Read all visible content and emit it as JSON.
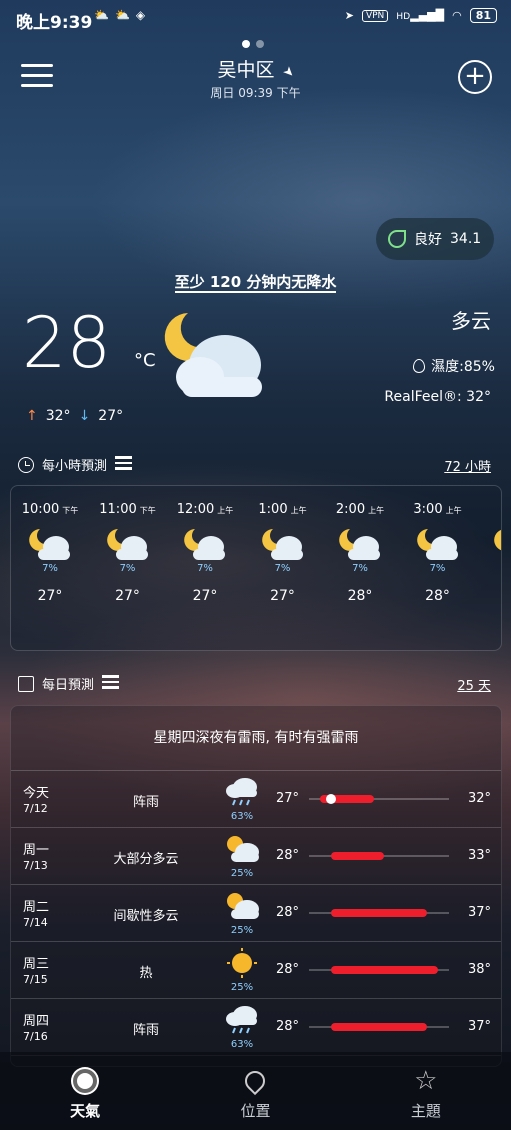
{
  "status_bar": {
    "time": "晚上9:39",
    "vpn": "VPN",
    "signal": "HD",
    "battery": "81"
  },
  "header": {
    "city": "吴中区",
    "datetime": "周日 09:39 下午",
    "page_count": 2,
    "active_page": 1
  },
  "air_quality": {
    "label": "良好",
    "value": "34.1",
    "color": "#7fe08a"
  },
  "nowcast": "至少 120 分钟内无降水",
  "current": {
    "temperature": "28",
    "unit": "°C",
    "condition": "多云",
    "humidity": "濕度:85%",
    "realfeel": "RealFeel®: 32°",
    "high": "32°",
    "low": "27°",
    "icon": "partly-cloudy-night-icon"
  },
  "hourly": {
    "title": "每小時預測",
    "link": "72 小時",
    "items": [
      {
        "time": "10:00",
        "period": "下午",
        "precip": "7%",
        "temp": "27°",
        "icon": "partly-cloudy-night-icon"
      },
      {
        "time": "11:00",
        "period": "下午",
        "precip": "7%",
        "temp": "27°",
        "icon": "partly-cloudy-night-icon"
      },
      {
        "time": "12:00",
        "period": "上午",
        "precip": "7%",
        "temp": "27°",
        "icon": "partly-cloudy-night-icon"
      },
      {
        "time": "1:00",
        "period": "上午",
        "precip": "7%",
        "temp": "27°",
        "icon": "partly-cloudy-night-icon"
      },
      {
        "time": "2:00",
        "period": "上午",
        "precip": "7%",
        "temp": "28°",
        "icon": "partly-cloudy-night-icon"
      },
      {
        "time": "3:00",
        "period": "上午",
        "precip": "7%",
        "temp": "28°",
        "icon": "partly-cloudy-night-icon"
      },
      {
        "time": "4:",
        "period": "",
        "precip": "",
        "temp": "",
        "icon": "partly-cloudy-night-icon"
      }
    ]
  },
  "daily": {
    "title": "每日預測",
    "link": "25 天",
    "summary": "星期四深夜有雷雨, 有时有强雷雨",
    "range_min": 26,
    "range_max": 39,
    "rows": [
      {
        "day": "今天",
        "date": "7/12",
        "cond": "阵雨",
        "precip": "63%",
        "lo": "27°",
        "hi": "32°",
        "lo_val": 27,
        "hi_val": 32,
        "current_val": 28,
        "icon": "rain-icon"
      },
      {
        "day": "周一",
        "date": "7/13",
        "cond": "大部分多云",
        "precip": "25%",
        "lo": "28°",
        "hi": "33°",
        "lo_val": 28,
        "hi_val": 33,
        "icon": "partly-cloudy-day-icon"
      },
      {
        "day": "周二",
        "date": "7/14",
        "cond": "间歇性多云",
        "precip": "25%",
        "lo": "28°",
        "hi": "37°",
        "lo_val": 28,
        "hi_val": 37,
        "icon": "partly-cloudy-day-icon"
      },
      {
        "day": "周三",
        "date": "7/15",
        "cond": "热",
        "precip": "25%",
        "lo": "28°",
        "hi": "38°",
        "lo_val": 28,
        "hi_val": 38,
        "icon": "sun-icon"
      },
      {
        "day": "周四",
        "date": "7/16",
        "cond": "阵雨",
        "precip": "63%",
        "lo": "28°",
        "hi": "37°",
        "lo_val": 28,
        "hi_val": 37,
        "icon": "rain-icon"
      }
    ]
  },
  "nav": {
    "weather": "天氣",
    "location": "位置",
    "theme": "主題"
  },
  "colors": {
    "bar": "#ee1e2c",
    "precip": "#8fd0ff",
    "high_arrow": "#ff8a4a",
    "low_arrow": "#5fbaf0"
  }
}
